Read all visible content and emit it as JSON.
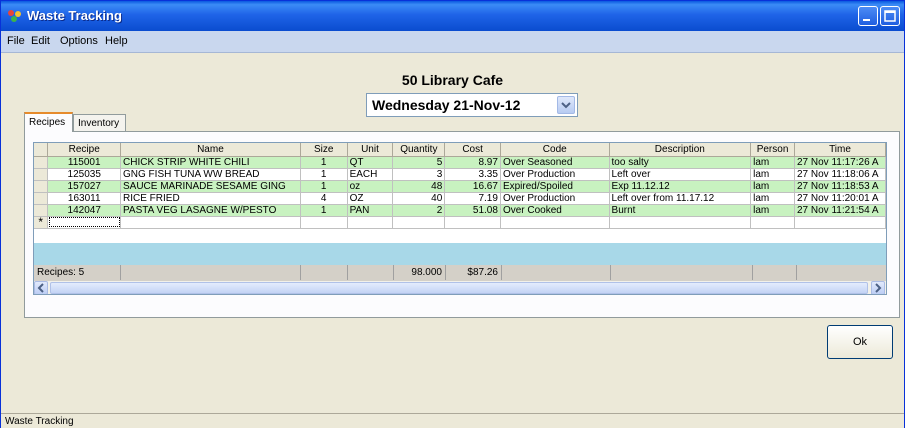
{
  "window": {
    "title": "Waste Tracking"
  },
  "menu": [
    "File",
    "Edit",
    "Options",
    "Help"
  ],
  "header": {
    "cafe": "50 Library Cafe",
    "date": "Wednesday 21-Nov-12"
  },
  "tabs": [
    "Recipes",
    "Inventory"
  ],
  "grid": {
    "columns": [
      "Recipe",
      "Name",
      "Size",
      "Unit",
      "Quantity",
      "Cost",
      "Code",
      "Description",
      "Person",
      "Time"
    ],
    "rows": [
      [
        "115001",
        "CHICK STRIP WHITE CHILI",
        "1",
        "QT",
        "5",
        "8.97",
        "Over Seasoned",
        "too salty",
        "lam",
        "27 Nov 11:17:26 A"
      ],
      [
        "125035",
        "GNG FISH TUNA WW BREAD",
        "1",
        "EACH",
        "3",
        "3.35",
        "Over Production",
        "Left over",
        "lam",
        "27 Nov 11:18:06 A"
      ],
      [
        "157027",
        "SAUCE MARINADE SESAME GING",
        "1",
        "oz",
        "48",
        "16.67",
        "Expired/Spoiled",
        "Exp 11.12.12",
        "lam",
        "27 Nov 11:18:53 A"
      ],
      [
        "163011",
        "RICE FRIED",
        "4",
        "OZ",
        "40",
        "7.19",
        "Over Production",
        "Left over from 11.17.12",
        "lam",
        "27 Nov 11:20:01 A"
      ],
      [
        "142047",
        "PASTA VEG LASAGNE W/PESTO",
        "1",
        "PAN",
        "2",
        "51.08",
        "Over Cooked",
        "Burnt",
        "lam",
        "27 Nov 11:21:54 A"
      ]
    ],
    "new_row_marker": "*",
    "summary": {
      "count": "Recipes: 5",
      "quantity": "98.000",
      "cost": "$87.26"
    }
  },
  "buttons": {
    "ok": "Ok"
  },
  "status": {
    "text": "Waste Tracking"
  },
  "colors": {
    "title_bar": "#1f64e8",
    "row_green": "#c8f2c0",
    "band_blue": "#a8d8e8",
    "tab_highlight": "#e68b2c"
  }
}
